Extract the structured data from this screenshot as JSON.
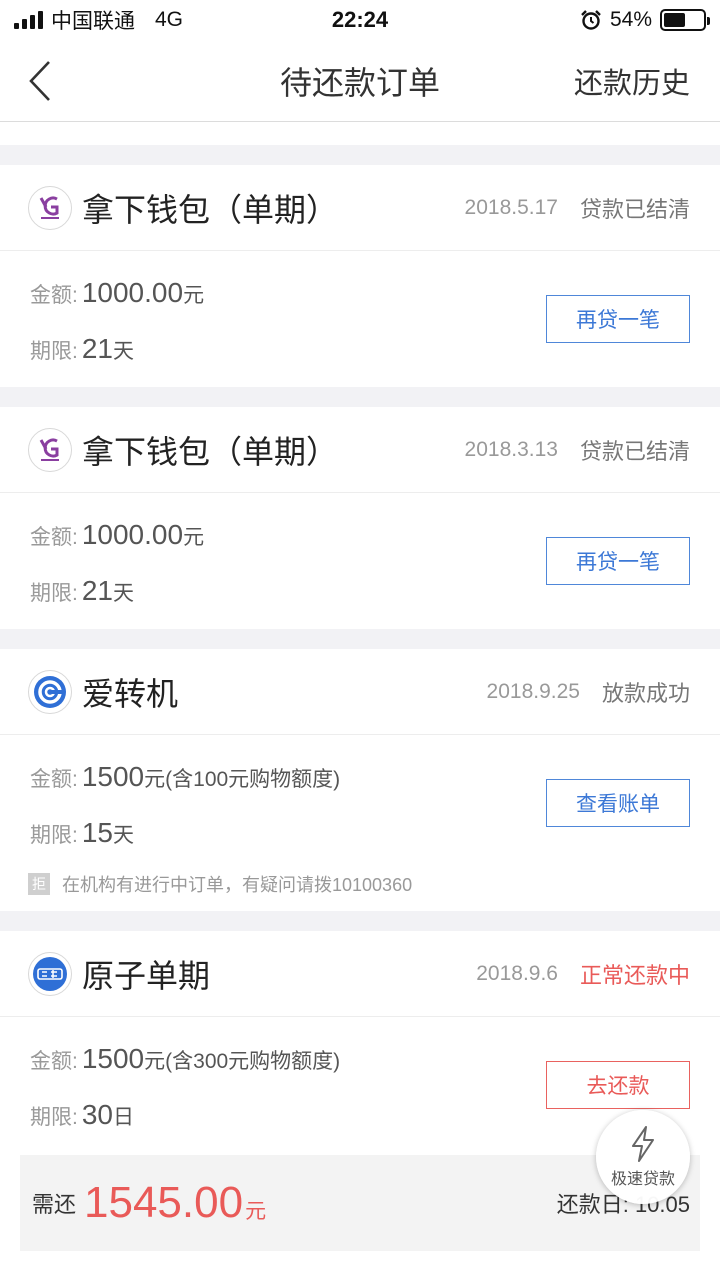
{
  "status_bar": {
    "carrier": "中国联通",
    "network": "4G",
    "time": "22:24",
    "battery": "54%",
    "battery_level": 0.54
  },
  "nav": {
    "title": "待还款订单",
    "history": "还款历史"
  },
  "labels": {
    "amount": "金额:",
    "term": "期限:"
  },
  "orders": [
    {
      "name": "拿下钱包（单期）",
      "date": "2018.5.17",
      "status": "贷款已结清",
      "amount": "1000.00",
      "amount_unit": "元",
      "amount_extra": "",
      "term": "21",
      "term_unit": "天",
      "button": "再贷一笔"
    },
    {
      "name": "拿下钱包（单期）",
      "date": "2018.3.13",
      "status": "贷款已结清",
      "amount": "1000.00",
      "amount_unit": "元",
      "amount_extra": "",
      "term": "21",
      "term_unit": "天",
      "button": "再贷一笔"
    },
    {
      "name": "爱转机",
      "date": "2018.9.25",
      "status": "放款成功",
      "amount": "1500",
      "amount_unit": "元",
      "amount_extra": "(含100元购物额度)",
      "term": "15",
      "term_unit": "天",
      "button": "查看账单",
      "notice_badge": "拒",
      "notice": "在机构有进行中订单，有疑问请拨10100360"
    },
    {
      "name": "原子单期",
      "date": "2018.9.6",
      "status": "正常还款中",
      "amount": "1500",
      "amount_unit": "元",
      "amount_extra": "(含300元购物额度)",
      "term": "30",
      "term_unit": "日",
      "button": "去还款",
      "due_label": "需还",
      "due_amount": "1545.00",
      "due_unit": "元",
      "due_date": "还款日: 10.05"
    }
  ],
  "fab": {
    "label": "极速贷款"
  },
  "colors": {
    "accent_blue": "#3c78d6",
    "accent_red": "#e95a58",
    "divider_bg": "#f2f2f5",
    "logo_purple": "#8a3fa0",
    "logo_blue": "#2f6fd6"
  }
}
